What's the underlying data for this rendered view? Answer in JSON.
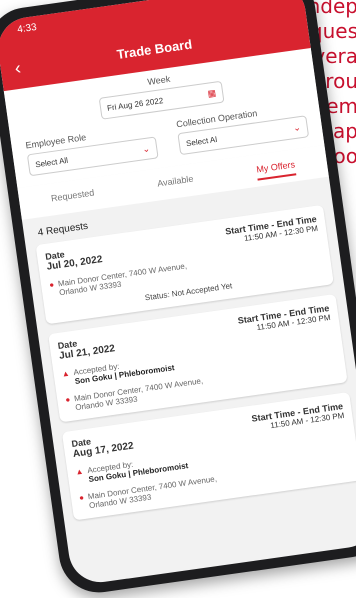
{
  "background_text": [
    "or indep",
    "reques",
    "covera",
    "throu",
    "Hem",
    "in-ap",
    "Boo"
  ],
  "status_bar": {
    "time": "4:33",
    "icons": "wifi battery"
  },
  "header": {
    "title": "Trade Board",
    "back_icon": "chevron-left-icon"
  },
  "filters": {
    "week_label": "Week",
    "week_value": "Fri Aug 26 2022",
    "employee_role_label": "Employee Role",
    "employee_role_value": "Select All",
    "collection_operation_label": "Collection Operation",
    "collection_operation_value": "Select Al"
  },
  "tabs": [
    {
      "label": "Requested",
      "active": false
    },
    {
      "label": "Available",
      "active": false
    },
    {
      "label": "My Offers",
      "active": true
    }
  ],
  "requests_count": "4 Requests",
  "cards": [
    {
      "date_label": "Date",
      "date": "Jul 20, 2022",
      "time_label": "Start Time - End Time",
      "times": "11:50 AM  -  12:30 PM",
      "address_line1": "Main Donor Center, 7400 W Avenue,",
      "address_line2": "Orlando W 33393",
      "status": "Status: Not Accepted Yet"
    },
    {
      "date_label": "Date",
      "date": "Jul 21, 2022",
      "time_label": "Start Time - End Time",
      "times": "11:50 AM  -  12:30 PM",
      "accepted_label": "Accepted by:",
      "accepted_name": "Son Goku | Phleboromoist",
      "address_line1": "Main Donor Center, 7400 W Avenue,",
      "address_line2": "Orlando W 33393"
    },
    {
      "date_label": "Date",
      "date": "Aug 17, 2022",
      "time_label": "Start Time - End Time",
      "times": "11:50 AM  -  12:30 PM",
      "accepted_label": "Accepted by:",
      "accepted_name": "Son Goku | Phleboromoist",
      "address_line1": "Main Donor Center, 7400 W Avenue,",
      "address_line2": "Orlando W 33393"
    }
  ],
  "colors": {
    "accent": "#d9242f",
    "marketing_text": "#c8102e"
  }
}
